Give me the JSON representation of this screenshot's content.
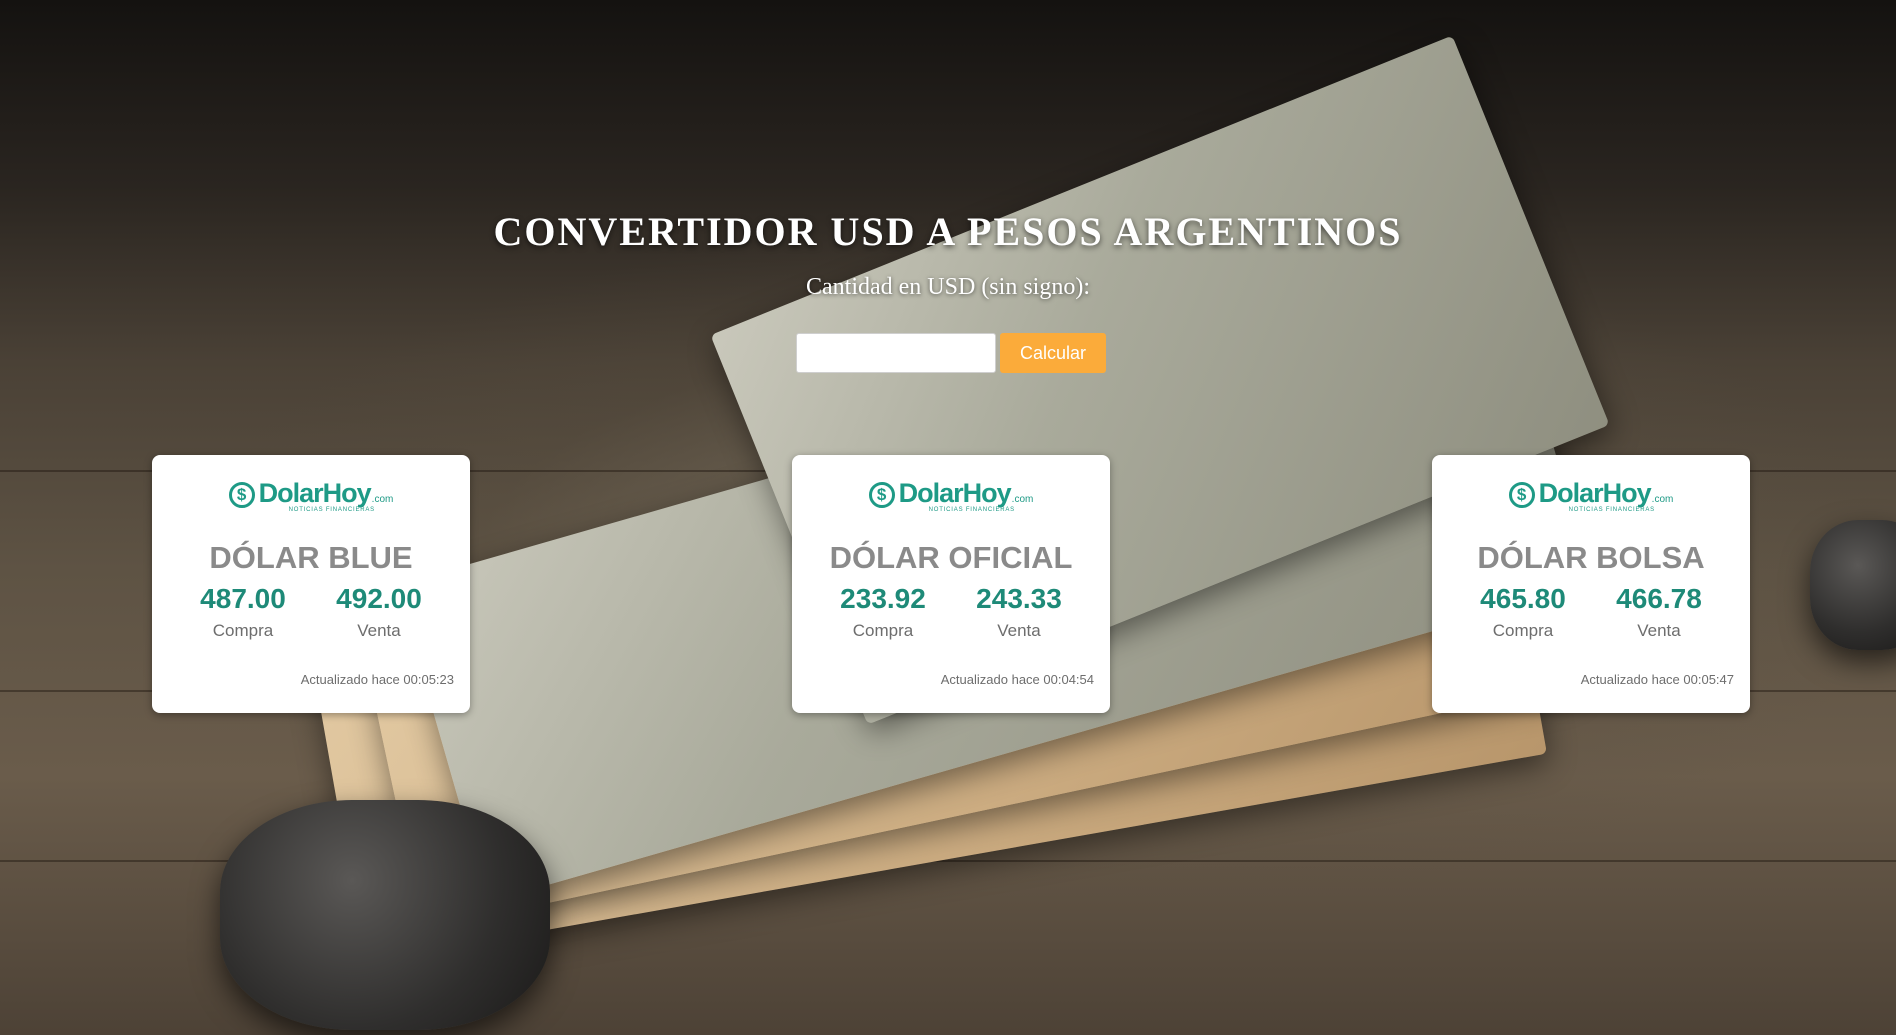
{
  "page": {
    "title": "CONVERTIDOR USD A PESOS ARGENTINOS",
    "input_label": "Cantidad en USD (sin signo):",
    "input_value": "",
    "input_placeholder": "",
    "calc_button": "Calcular"
  },
  "logo": {
    "coin_symbol": "$",
    "word": "DolarHoy",
    "suffix": ".com",
    "tagline": "NOTICIAS FINANCIERAS"
  },
  "cards": [
    {
      "title": "DÓLAR BLUE",
      "buy_value": "487.00",
      "buy_label": "Compra",
      "sell_value": "492.00",
      "sell_label": "Venta",
      "updated": "Actualizado hace 00:05:23"
    },
    {
      "title": "DÓLAR OFICIAL",
      "buy_value": "233.92",
      "buy_label": "Compra",
      "sell_value": "243.33",
      "sell_label": "Venta",
      "updated": "Actualizado hace 00:04:54"
    },
    {
      "title": "DÓLAR BOLSA",
      "buy_value": "465.80",
      "buy_label": "Compra",
      "sell_value": "466.78",
      "sell_label": "Venta",
      "updated": "Actualizado hace 00:05:47"
    }
  ],
  "colors": {
    "accent_button": "#fbab3a",
    "rate_value": "#1e8a78",
    "logo": "#1e9a86",
    "card_title": "#8a8a8a"
  }
}
